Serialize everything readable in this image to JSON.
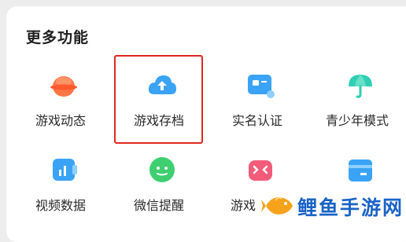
{
  "section": {
    "title": "更多功能"
  },
  "items": [
    {
      "label": "游戏动态",
      "icon": "game-news-icon"
    },
    {
      "label": "游戏存档",
      "icon": "cloud-upload-icon"
    },
    {
      "label": "实名认证",
      "icon": "id-card-icon"
    },
    {
      "label": "青少年模式",
      "icon": "umbrella-icon"
    },
    {
      "label": "视频数据",
      "icon": "video-stats-icon"
    },
    {
      "label": "微信提醒",
      "icon": "wechat-bubble-icon"
    },
    {
      "label": "游戏",
      "icon": "gamepad-icon"
    },
    {
      "label": "",
      "icon": "folder-icon"
    }
  ],
  "watermark": {
    "text": "鲤鱼手游网"
  },
  "colors": {
    "orange": "#ff7545",
    "blue": "#3aa3f5",
    "teal": "#2fcfb3",
    "green": "#3fcf70",
    "pink": "#f25b7a",
    "highlight": "#e0281f",
    "watermark": "#1a63c7"
  }
}
